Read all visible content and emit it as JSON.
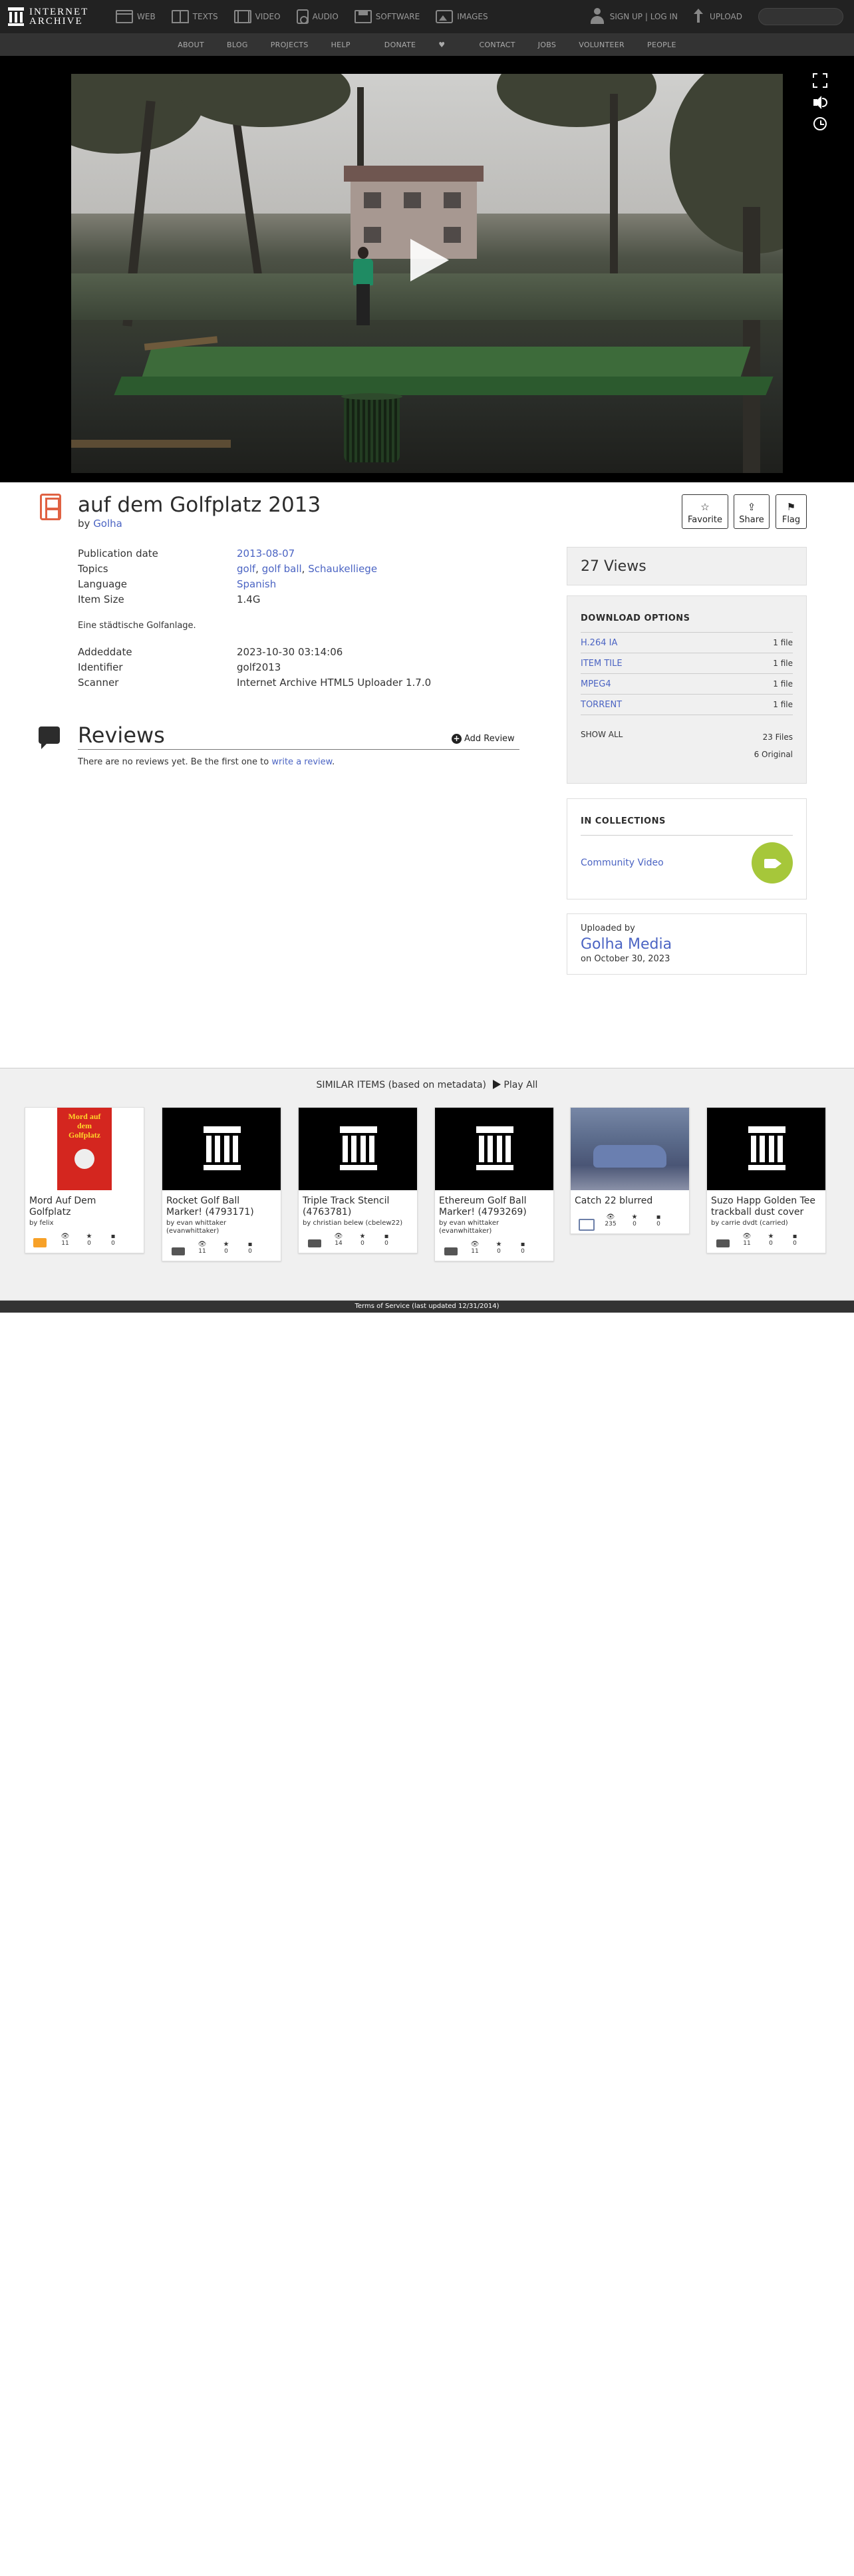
{
  "colors": {
    "topnav_bg": "#222222",
    "subnav_bg": "#333333",
    "link": "#4b64c3",
    "movie_icon": "#e06243",
    "collection_badge": "#a6c73a"
  },
  "topnav": {
    "logo_line1": "INTERNET",
    "logo_line2": "ARCHIVE",
    "links": [
      {
        "label": "WEB",
        "icon": "web-icon"
      },
      {
        "label": "TEXTS",
        "icon": "texts-icon"
      },
      {
        "label": "VIDEO",
        "icon": "video-icon"
      },
      {
        "label": "AUDIO",
        "icon": "audio-icon"
      },
      {
        "label": "SOFTWARE",
        "icon": "software-icon"
      },
      {
        "label": "IMAGES",
        "icon": "images-icon"
      }
    ],
    "signup_label": "SIGN UP | LOG IN",
    "upload_label": "UPLOAD",
    "search_placeholder": ""
  },
  "subnav": {
    "items": [
      "ABOUT",
      "BLOG",
      "PROJECTS",
      "HELP",
      "DONATE",
      "CONTACT",
      "JOBS",
      "VOLUNTEER",
      "PEOPLE"
    ]
  },
  "item": {
    "title": "auf dem Golfplatz 2013",
    "by_prefix": "by",
    "creator": "Golha",
    "actions": {
      "favorite": "Favorite",
      "share": "Share",
      "flag": "Flag"
    },
    "metadata": {
      "pubdate_key": "Publication date",
      "pubdate_val": "2013-08-07",
      "topics_key": "Topics",
      "topic1": "golf",
      "topic2": "golf ball",
      "topic3": "Schaukelliege",
      "language_key": "Language",
      "language_val": "Spanish",
      "size_key": "Item Size",
      "size_val": "1.4G"
    },
    "description": "Eine städtische Golfanlage.",
    "metadata2": {
      "addeddate_key": "Addeddate",
      "addeddate_val": "2023-10-30 03:14:06",
      "identifier_key": "Identifier",
      "identifier_val": "golf2013",
      "scanner_key": "Scanner",
      "scanner_val": "Internet Archive HTML5 Uploader 1.7.0"
    }
  },
  "reviews": {
    "title": "Reviews",
    "add_label": "Add Review",
    "empty_text": "There are no reviews yet. Be the first one to",
    "write_link": "write a review",
    "period": "."
  },
  "sidebar": {
    "views": "27 Views",
    "download_title": "DOWNLOAD OPTIONS",
    "downloads": [
      {
        "format": "H.264 IA",
        "count": "1 file"
      },
      {
        "format": "ITEM TILE",
        "count": "1 file"
      },
      {
        "format": "MPEG4",
        "count": "1 file"
      },
      {
        "format": "TORRENT",
        "count": "1 file"
      }
    ],
    "show_all": "SHOW ALL",
    "files_total": "23 Files",
    "files_original": "6 Original",
    "collections_title": "IN COLLECTIONS",
    "collection_name": "Community Video",
    "uploaded_by_label": "Uploaded by",
    "uploader": "Golha Media",
    "uploaded_on": "on October 30, 2023"
  },
  "similar": {
    "heading": "SIMILAR ITEMS (based on metadata)",
    "play_all": "Play All",
    "cards": [
      {
        "title": "Mord Auf Dem Golfplatz",
        "by": "by felix",
        "views": "11",
        "favs": "0",
        "reviews": "0",
        "type": "book",
        "cover_text": "Mord auf dem Golfplatz"
      },
      {
        "title": "Rocket Golf Ball Marker! (4793171)",
        "by": "by evan whittaker (evanwhittaker)",
        "views": "11",
        "favs": "0",
        "reviews": "0",
        "type": "folder"
      },
      {
        "title": "Triple Track Stencil (4763781)",
        "by": "by christian belew (cbelew22)",
        "views": "14",
        "favs": "0",
        "reviews": "0",
        "type": "folder"
      },
      {
        "title": "Ethereum Golf Ball Marker! (4793269)",
        "by": "by evan whittaker (evanwhittaker)",
        "views": "11",
        "favs": "0",
        "reviews": "0",
        "type": "folder"
      },
      {
        "title": "Catch 22 blurred",
        "by": "",
        "views": "235",
        "favs": "0",
        "reviews": "0",
        "type": "movie"
      },
      {
        "title": "Suzo Happ Golden Tee trackball dust cover",
        "by": "by carrie dvdt (carried)",
        "views": "11",
        "favs": "0",
        "reviews": "0",
        "type": "folder"
      }
    ]
  },
  "footer": {
    "text": "Terms of Service (last updated 12/31/2014)"
  }
}
